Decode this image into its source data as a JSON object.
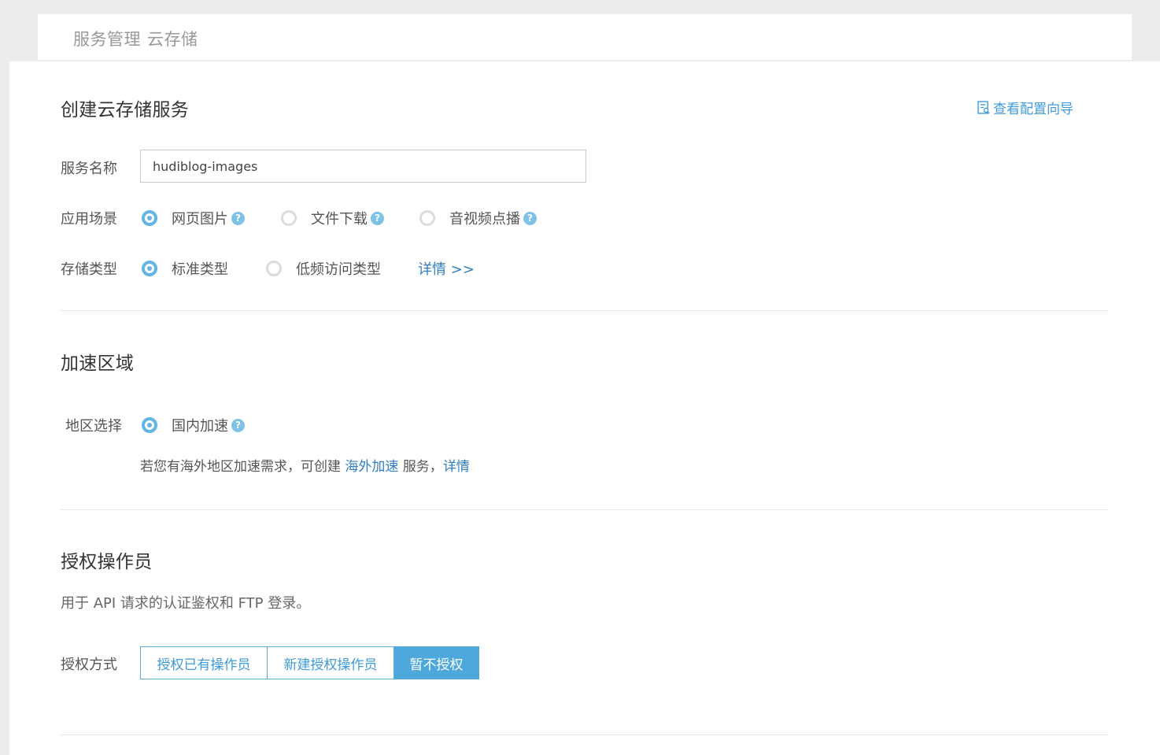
{
  "breadcrumb": {
    "parent": "服务管理",
    "current": "云存储"
  },
  "create": {
    "title": "创建云存储服务",
    "guide_link": "查看配置向导",
    "service_name_label": "服务名称",
    "service_name_value": "hudiblog-images",
    "scene_label": "应用场景",
    "scene_options": [
      {
        "label": "网页图片",
        "checked": true
      },
      {
        "label": "文件下载",
        "checked": false
      },
      {
        "label": "音视频点播",
        "checked": false
      }
    ],
    "storage_label": "存储类型",
    "storage_options": [
      {
        "label": "标准类型",
        "checked": true
      },
      {
        "label": "低频访问类型",
        "checked": false
      }
    ],
    "storage_detail_link": "详情 >>"
  },
  "acceleration": {
    "title": "加速区域",
    "region_label": "地区选择",
    "region_option": "国内加速",
    "note_prefix": "若您有海外地区加速需求，可创建",
    "note_link": "海外加速",
    "note_middle": "服务，",
    "note_detail": "详情"
  },
  "operator": {
    "title": "授权操作员",
    "description": "用于 API 请求的认证鉴权和 FTP 登录。",
    "mode_label": "授权方式",
    "modes": [
      {
        "label": "授权已有操作员",
        "active": false
      },
      {
        "label": "新建授权操作员",
        "active": false
      },
      {
        "label": "暂不授权",
        "active": true
      }
    ]
  },
  "colors": {
    "accent": "#4fa8dc",
    "link": "#2e7fc2",
    "help_icon": "#7ec3e6"
  },
  "icons": {
    "guide": "document-guide-icon",
    "help": "question-circle-icon"
  }
}
